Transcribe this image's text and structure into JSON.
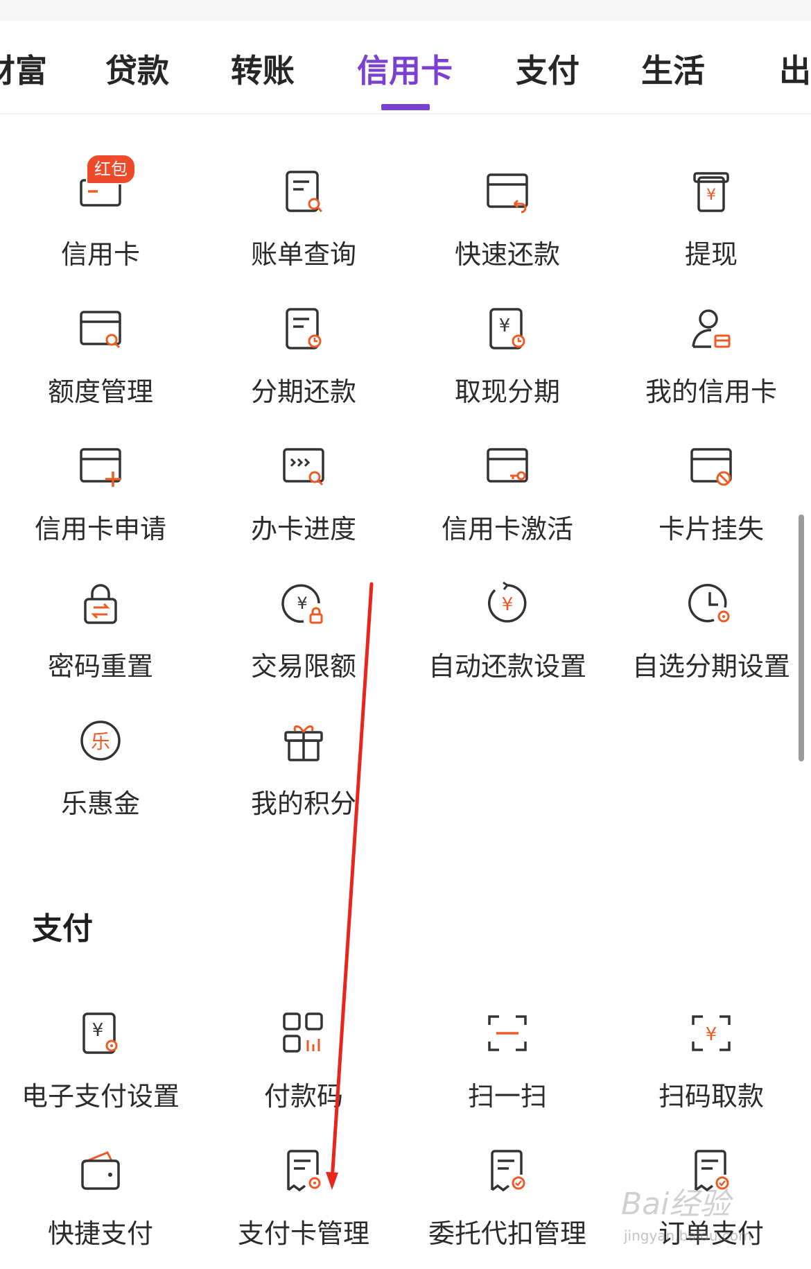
{
  "tabs": [
    {
      "label": "财富",
      "active": false
    },
    {
      "label": "贷款",
      "active": false
    },
    {
      "label": "转账",
      "active": false
    },
    {
      "label": "信用卡",
      "active": true
    },
    {
      "label": "支付",
      "active": false
    },
    {
      "label": "生活",
      "active": false
    },
    {
      "label": "出国",
      "active": false
    }
  ],
  "credit_card_items": [
    {
      "label": "信用卡",
      "icon": "card-icon",
      "badge": "红包"
    },
    {
      "label": "账单查询",
      "icon": "bill-search-icon"
    },
    {
      "label": "快速还款",
      "icon": "card-return-icon"
    },
    {
      "label": "提现",
      "icon": "yuan-withdraw-icon"
    },
    {
      "label": "额度管理",
      "icon": "card-search-icon"
    },
    {
      "label": "分期还款",
      "icon": "bill-clock-icon"
    },
    {
      "label": "取现分期",
      "icon": "yuan-doc-clock-icon"
    },
    {
      "label": "我的信用卡",
      "icon": "user-card-icon"
    },
    {
      "label": "信用卡申请",
      "icon": "card-add-icon"
    },
    {
      "label": "办卡进度",
      "icon": "progress-search-icon"
    },
    {
      "label": "信用卡激活",
      "icon": "card-key-icon"
    },
    {
      "label": "卡片挂失",
      "icon": "card-block-icon"
    },
    {
      "label": "密码重置",
      "icon": "lock-swap-icon"
    },
    {
      "label": "交易限额",
      "icon": "yuan-lock-icon"
    },
    {
      "label": "自动还款设置",
      "icon": "yuan-refresh-icon"
    },
    {
      "label": "自选分期设置",
      "icon": "clock-settings-icon"
    },
    {
      "label": "乐惠金",
      "icon": "le-coin-icon"
    },
    {
      "label": "我的积分",
      "icon": "gift-icon"
    }
  ],
  "payment_section": {
    "title": "支付",
    "items": [
      {
        "label": "电子支付设置",
        "icon": "yuan-doc-settings-icon"
      },
      {
        "label": "付款码",
        "icon": "pay-code-icon"
      },
      {
        "label": "扫一扫",
        "icon": "scan-icon"
      },
      {
        "label": "扫码取款",
        "icon": "scan-yuan-icon"
      },
      {
        "label": "快捷支付",
        "icon": "wallet-icon"
      },
      {
        "label": "支付卡管理",
        "icon": "doc-settings-icon"
      },
      {
        "label": "委托代扣管理",
        "icon": "doc-check-icon"
      },
      {
        "label": "订单支付",
        "icon": "doc-check-icon"
      }
    ]
  },
  "watermark": {
    "brand": "Bai经验",
    "url": "jingyan.baidu.com"
  },
  "colors": {
    "accent": "#7b3fd1",
    "icon_orange": "#ee5a24",
    "icon_dark": "#333333",
    "badge": "#ee4b2b",
    "arrow": "#e8261e"
  }
}
